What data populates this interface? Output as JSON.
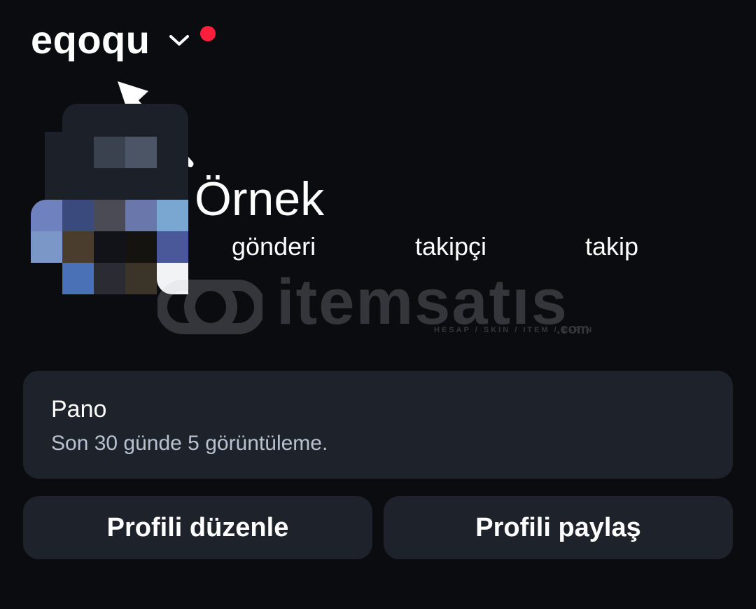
{
  "header": {
    "username": "eqoqu",
    "dropdown_icon": "chevron-down-icon",
    "notification_color": "#ff1f3d"
  },
  "profile": {
    "display_name": "Örnek",
    "stats": [
      {
        "label": "gönderi"
      },
      {
        "label": "takipçi"
      },
      {
        "label": "takip"
      }
    ]
  },
  "watermark": {
    "word": "itemsatıs",
    "tagline": "HESAP / SKIN / ITEM / E-PIN",
    "domain": ".com"
  },
  "dashboard": {
    "title": "Pano",
    "subtitle": "Son 30 günde 5 görüntüleme."
  },
  "actions": {
    "edit_profile_label": "Profili düzenle",
    "share_profile_label": "Profili paylaş"
  },
  "colors": {
    "background": "#0b0c10",
    "card": "#1e222b",
    "accent_dot": "#ff1f3d"
  }
}
